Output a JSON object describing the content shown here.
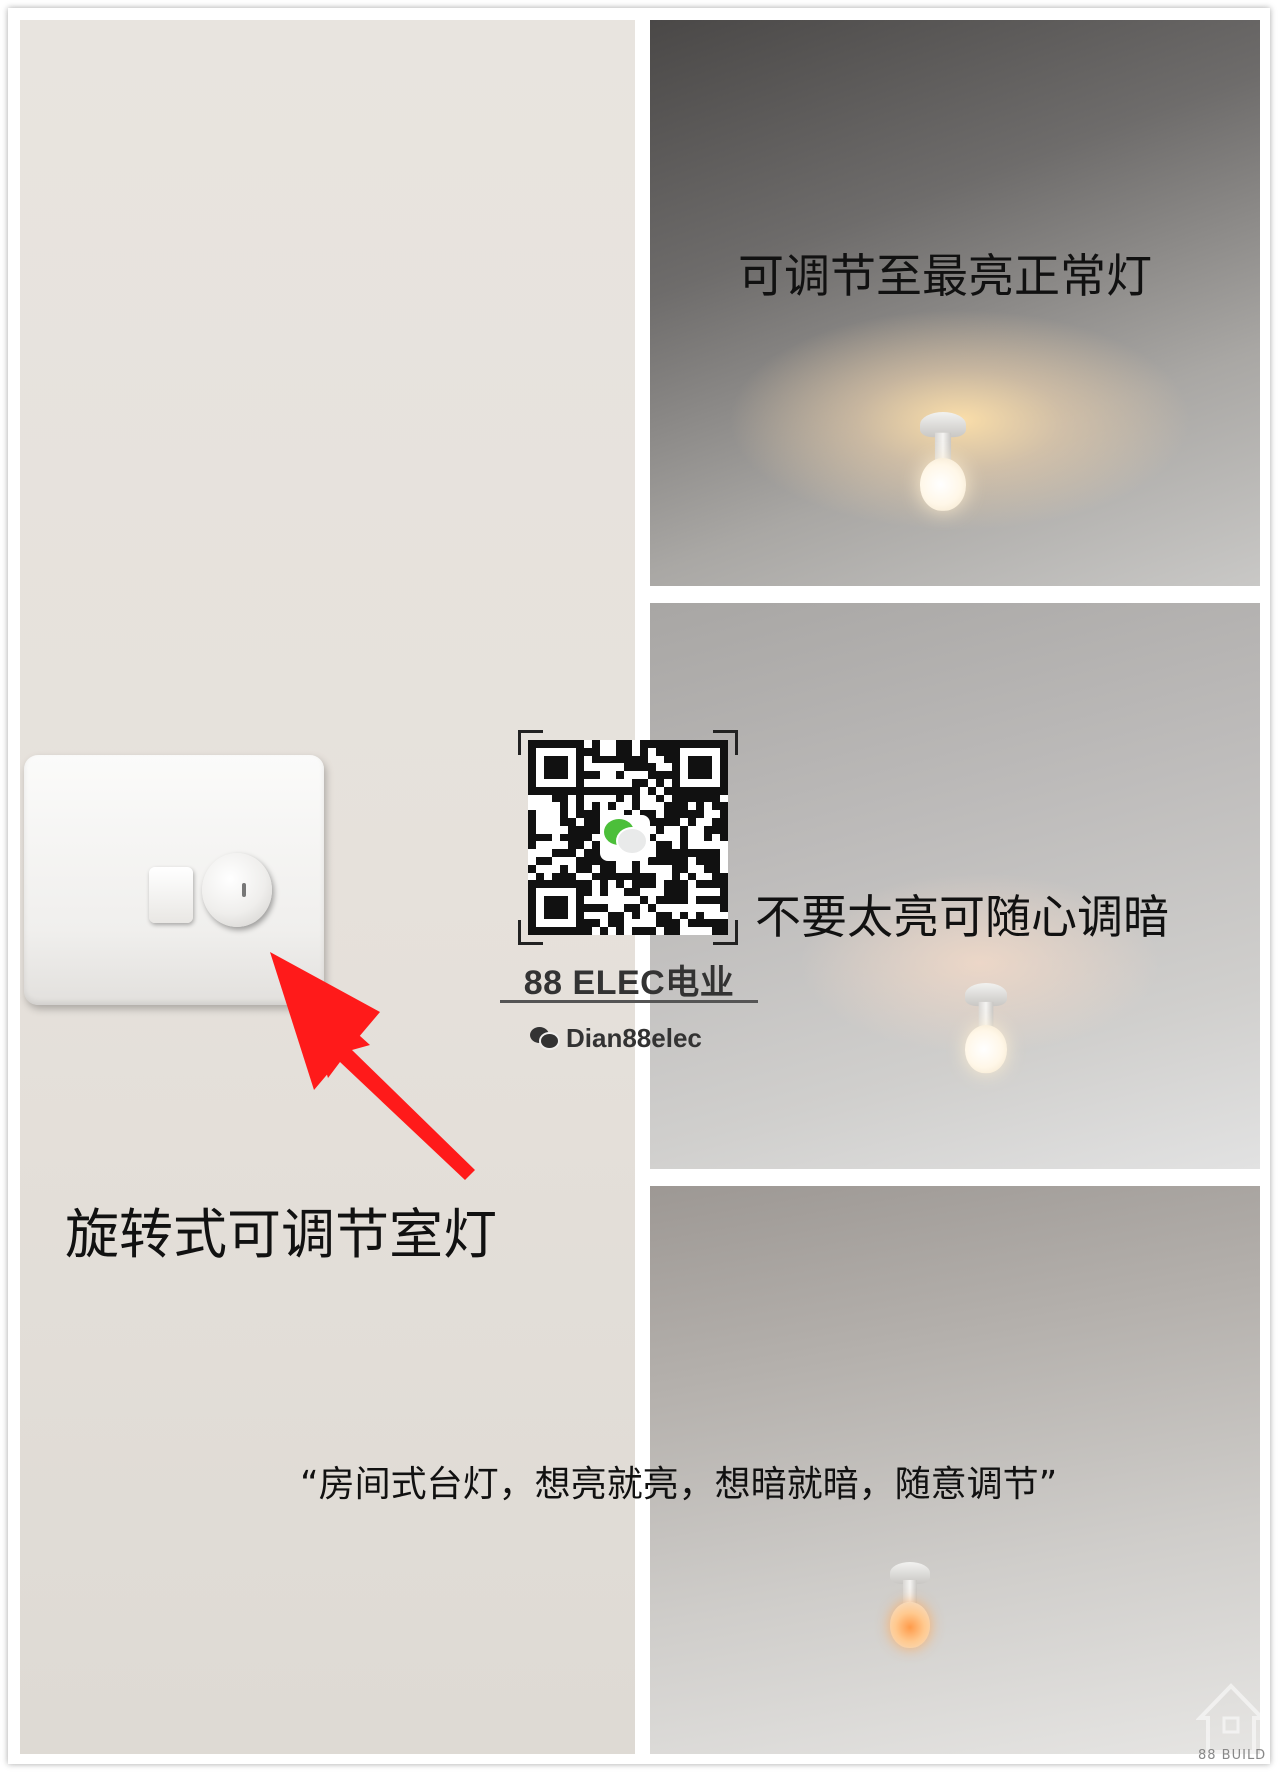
{
  "panels": {
    "left_caption": "旋转式可调节室灯",
    "top_caption": "可调节至最亮正常灯",
    "mid_caption": "不要太亮可随心调暗",
    "bottom_caption": "“房间式台灯，想亮就亮，想暗就暗，随意调节”"
  },
  "brand": {
    "name": "88 ELEC电业",
    "wechat_id": "Dian88elec",
    "icon": "wechat-icon"
  },
  "watermark": {
    "text": "88 BUILD",
    "icon": "house-icon"
  },
  "colors": {
    "arrow": "#ff1a1a",
    "wechat_green": "#4cbf3a"
  }
}
